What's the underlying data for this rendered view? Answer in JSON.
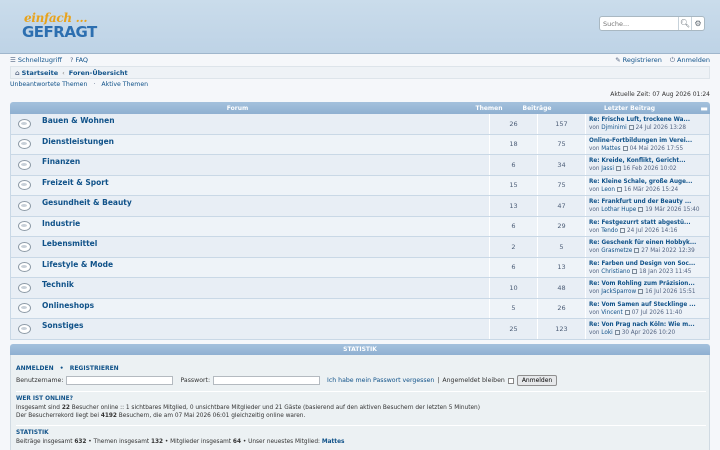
{
  "logo": {
    "line1": "einfach ...",
    "line2": "GEFRAGT"
  },
  "search": {
    "placeholder": "Suche...",
    "button_icon": "search-icon",
    "advanced_icon": "gear-icon"
  },
  "nav": {
    "quick": "Schnellzugriff",
    "faq": "FAQ",
    "register": "Registrieren",
    "login": "Anmelden"
  },
  "breadcrumb": {
    "home": "Startseite",
    "current": "Foren-Übersicht"
  },
  "links": {
    "unanswered": "Unbeantwortete Themen",
    "active": "Aktive Themen"
  },
  "time": "Aktuelle Zeit: 07 Aug 2026 01:24",
  "table": {
    "col_forum": "Forum",
    "col_topics": "Themen",
    "col_posts": "Beiträge",
    "col_last": "Letzter Beitrag",
    "col_menu": "▬"
  },
  "forums": [
    {
      "name": "Bauen & Wohnen",
      "topics": "26",
      "posts": "157",
      "last_title": "Re: Frische Luft, trockene Wa...",
      "by": "von",
      "user": "Djminimi",
      "date": "24 Jul 2026 13:28"
    },
    {
      "name": "Dienstleistungen",
      "topics": "18",
      "posts": "75",
      "last_title": "Online-Fortbildungen im Verei...",
      "by": "von",
      "user": "Mattes",
      "date": "04 Mai 2026 17:55"
    },
    {
      "name": "Finanzen",
      "topics": "6",
      "posts": "34",
      "last_title": "Re: Kreide, Konflikt, Gericht...",
      "by": "von",
      "user": "Jassi",
      "date": "16 Feb 2026 10:02"
    },
    {
      "name": "Freizeit & Sport",
      "topics": "15",
      "posts": "75",
      "last_title": "Re: Kleine Schale, große Auge...",
      "by": "von",
      "user": "Leon",
      "date": "16 Mär 2026 15:24"
    },
    {
      "name": "Gesundheit & Beauty",
      "topics": "13",
      "posts": "47",
      "last_title": "Re: Frankfurt und der Beauty ...",
      "by": "von",
      "user": "Lothar Hupe",
      "date": "19 Mär 2026 15:40"
    },
    {
      "name": "Industrie",
      "topics": "6",
      "posts": "29",
      "last_title": "Re: Festgezurrt statt abgestü...",
      "by": "von",
      "user": "Tendo",
      "date": "24 Jul 2026 14:16"
    },
    {
      "name": "Lebensmittel",
      "topics": "2",
      "posts": "5",
      "last_title": "Re: Geschenk für einen Hobbyk...",
      "by": "von",
      "user": "Grasmetze",
      "date": "27 Mai 2022 12:39"
    },
    {
      "name": "Lifestyle & Mode",
      "topics": "6",
      "posts": "13",
      "last_title": "Re: Farben und Design von Soc...",
      "by": "von",
      "user": "Christiano",
      "date": "18 Jan 2023 11:45"
    },
    {
      "name": "Technik",
      "topics": "10",
      "posts": "48",
      "last_title": "Re: Vom Rohling zum Präzision...",
      "by": "von",
      "user": "JackSparrow",
      "date": "16 Jul 2026 15:51"
    },
    {
      "name": "Onlineshops",
      "topics": "5",
      "posts": "26",
      "last_title": "Re: Vom Samen auf Stecklinge ...",
      "by": "von",
      "user": "Vincent",
      "date": "07 Jul 2026 11:40"
    },
    {
      "name": "Sonstiges",
      "topics": "25",
      "posts": "123",
      "last_title": "Re: Von Prag nach Köln: Wie m...",
      "by": "von",
      "user": "Loki",
      "date": "30 Apr 2026 10:20"
    }
  ],
  "stats_bar": "STATISTIK",
  "login": {
    "heading_login": "ANMELDEN",
    "heading_sep": "•",
    "heading_register": "REGISTRIEREN",
    "user_label": "Benutzername:",
    "pass_label": "Passwort:",
    "forgot": "Ich habe mein Passwort vergessen",
    "sep": "|",
    "remember": "Angemeldet bleiben",
    "button": "Anmelden"
  },
  "online": {
    "heading": "WER IST ONLINE?",
    "line1_pre": "Insgesamt sind ",
    "line1_num": "22",
    "line1_post": " Besucher online :: 1 sichtbares Mitglied, 0 unsichtbare Mitglieder und 21 Gäste (basierend auf den aktiven Besuchern der letzten 5 Minuten)",
    "line2_pre": "Der Besucherrekord liegt bei ",
    "line2_num": "4192",
    "line2_post": " Besuchern, die am 07 Mai 2026 06:01 gleichzeitig online waren."
  },
  "statistik": {
    "heading": "STATISTIK",
    "pre1": "Beiträge insgesamt ",
    "posts": "632",
    "pre2": " • Themen insgesamt ",
    "topics": "132",
    "pre3": " • Mitglieder insgesamt ",
    "members": "64",
    "pre4": " • Unser neuestes Mitglied: ",
    "newest": "Mattes"
  }
}
